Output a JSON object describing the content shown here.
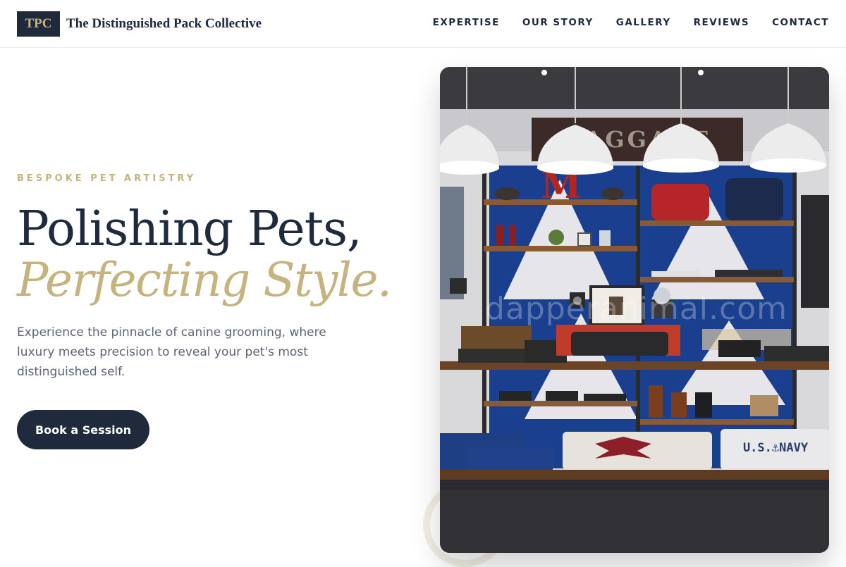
{
  "header": {
    "logo_text": "TPC",
    "brand_name": "The Distinguished Pack Collective",
    "nav": [
      "EXPERTISE",
      "OUR STORY",
      "GALLERY",
      "REVIEWS",
      "CONTACT"
    ]
  },
  "hero": {
    "eyebrow": "BESPOKE PET ARTISTRY",
    "headline_line1": "Polishing Pets,",
    "headline_line2": "Perfecting Style.",
    "lead": "Experience the pinnacle of canine grooming, where luxury meets precision to reveal your pet's most distinguished self.",
    "cta_label": "Book a Session"
  },
  "photo": {
    "watermark": "dapperanimal.com",
    "sign_text": "BAGGAGE",
    "letter_sign": "M",
    "shirt_text": "U.S.⚓NAVY",
    "icons": [
      "pendant-lamp-icon",
      "camera-icon",
      "picture-frame-icon"
    ]
  },
  "colors": {
    "navy": "#1f2a3d",
    "gold": "#c5b47f",
    "text_muted": "#5d6474",
    "background": "#ffffff"
  }
}
